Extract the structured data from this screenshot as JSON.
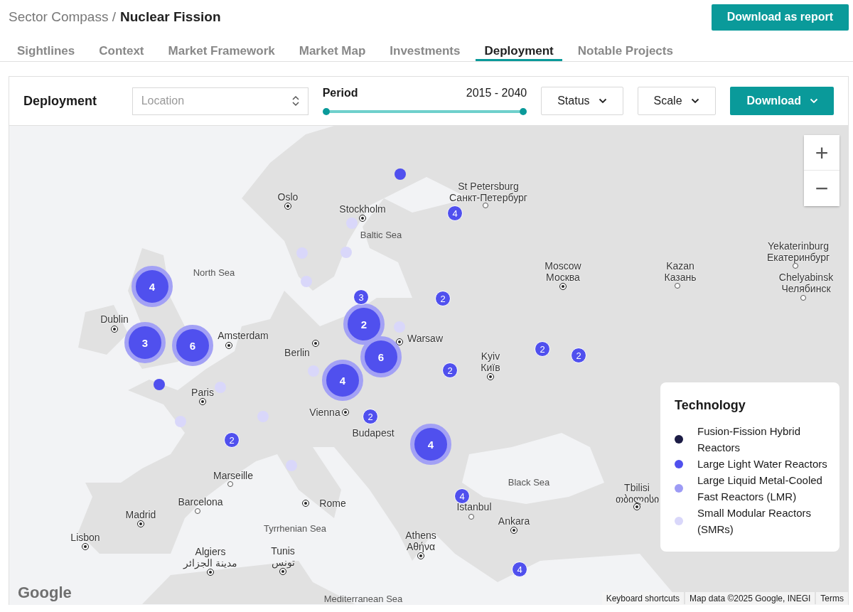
{
  "breadcrumb": {
    "parent": "Sector Compass /",
    "current": "Nuclear Fission"
  },
  "report_button": "Download as report",
  "tabs": [
    {
      "label": "Sightlines",
      "selected": false
    },
    {
      "label": "Context",
      "selected": false
    },
    {
      "label": "Market Framework",
      "selected": false
    },
    {
      "label": "Market Map",
      "selected": false
    },
    {
      "label": "Investments",
      "selected": false
    },
    {
      "label": "Deployment",
      "selected": true
    },
    {
      "label": "Notable Projects",
      "selected": false
    }
  ],
  "toolbar": {
    "title": "Deployment",
    "location": {
      "placeholder": "Location"
    },
    "period": {
      "label": "Period",
      "range": "2015 - 2040",
      "level": 1
    },
    "buttons": [
      {
        "label": "Status",
        "kind": "outline"
      },
      {
        "label": "Scale",
        "kind": "outline"
      },
      {
        "label": "Download",
        "kind": "primary"
      }
    ]
  },
  "map": {
    "cities": [
      {
        "name": "Oslo",
        "kind": "capital"
      },
      {
        "name": "Stockholm",
        "kind": "capital"
      },
      {
        "name": "St Petersburg",
        "native": "Санкт-Петербург",
        "kind": "city"
      },
      {
        "name": "Moscow",
        "native": "Москва",
        "kind": "capital"
      },
      {
        "name": "Kazan",
        "native": "Казань",
        "kind": "city"
      },
      {
        "name": "Yekaterinburg",
        "native": "Екатеринбург",
        "kind": "city"
      },
      {
        "name": "Chelyabinsk",
        "native": "Челябинск",
        "kind": "city"
      },
      {
        "name": "Dublin",
        "kind": "capital"
      },
      {
        "name": "Amsterdam",
        "kind": "capital"
      },
      {
        "name": "Berlin",
        "kind": "capital"
      },
      {
        "name": "Warsaw",
        "kind": "capital"
      },
      {
        "name": "Paris",
        "kind": "capital"
      },
      {
        "name": "Vienna",
        "kind": "capital"
      },
      {
        "name": "Budapest"
      },
      {
        "name": "Kyiv",
        "native": "Київ",
        "kind": "capital"
      },
      {
        "name": "Marseille",
        "kind": "city"
      },
      {
        "name": "Barcelona",
        "kind": "city"
      },
      {
        "name": "Madrid",
        "kind": "capital"
      },
      {
        "name": "Rome",
        "kind": "capital"
      },
      {
        "name": "Lisbon",
        "kind": "capital"
      },
      {
        "name": "Algiers",
        "native": "مدينة الجزائر",
        "kind": "capital"
      },
      {
        "name": "Tunis",
        "native": "تونس",
        "kind": "capital"
      },
      {
        "name": "Athens",
        "native": "Αθήνα",
        "kind": "capital"
      },
      {
        "name": "Istanbul",
        "kind": "city"
      },
      {
        "name": "Ankara",
        "kind": "capital"
      },
      {
        "name": "Tbilisi",
        "native": "თბილისი",
        "kind": "capital"
      }
    ],
    "seas": [
      "North Sea",
      "Baltic Sea",
      "Black Sea",
      "Tyrrhenian Sea",
      "Mediterranean Sea"
    ],
    "markers": [
      {
        "kind": "dot",
        "color": "#5050ee"
      },
      {
        "kind": "dot",
        "color": "#d9d7fa"
      },
      {
        "kind": "dot",
        "color": "#d9d7fa"
      },
      {
        "kind": "dot",
        "color": "#d9d7fa"
      },
      {
        "kind": "dot",
        "color": "#d9d7fa"
      },
      {
        "kind": "dot",
        "color": "#d9d7fa"
      },
      {
        "kind": "dot",
        "color": "#5050ee"
      },
      {
        "kind": "dot",
        "color": "#d9d7fa"
      },
      {
        "kind": "dot",
        "color": "#d9d7fa"
      },
      {
        "kind": "dot",
        "color": "#d9d7fa"
      },
      {
        "kind": "dot",
        "color": "#d9d7fa"
      },
      {
        "kind": "dot",
        "color": "#d9d7fa"
      },
      {
        "kind": "bubble",
        "count": "4",
        "color": "#5050ee"
      },
      {
        "kind": "bubble",
        "count": "3",
        "color": "#5050ee"
      },
      {
        "kind": "bubble",
        "count": "6",
        "color": "#5050ee"
      },
      {
        "kind": "bubble",
        "count": "2",
        "color": "#5050ee"
      },
      {
        "kind": "bubble",
        "count": "6",
        "color": "#5050ee"
      },
      {
        "kind": "bubble",
        "count": "4",
        "color": "#5050ee"
      },
      {
        "kind": "bubble",
        "count": "4",
        "color": "#5050ee"
      },
      {
        "kind": "cluster",
        "count": "4",
        "color": "#5050ee"
      },
      {
        "kind": "cluster",
        "count": "3",
        "color": "#5050ee"
      },
      {
        "kind": "cluster",
        "count": "2",
        "color": "#5050ee"
      },
      {
        "kind": "cluster",
        "count": "2",
        "color": "#5050ee"
      },
      {
        "kind": "cluster",
        "count": "2",
        "color": "#5050ee"
      },
      {
        "kind": "cluster",
        "count": "2",
        "color": "#5050ee"
      },
      {
        "kind": "cluster",
        "count": "2",
        "color": "#5050ee"
      },
      {
        "kind": "cluster",
        "count": "2",
        "color": "#5050ee"
      },
      {
        "kind": "cluster",
        "count": "4",
        "color": "#5050ee"
      },
      {
        "kind": "cluster",
        "count": "4",
        "color": "#5050ee"
      }
    ],
    "zoom": {
      "in": "+",
      "out": "−"
    },
    "legend": {
      "title": "Technology",
      "items": [
        {
          "label": "Fusion-Fission Hybrid Reactors",
          "color": "#1c1c45"
        },
        {
          "label": "Large Light Water Reactors",
          "color": "#5050ee"
        },
        {
          "label": "Large Liquid Metal-Cooled Fast Reactors (LMR)",
          "color": "#9d9bf5"
        },
        {
          "label": "Small Modular Reactors (SMRs)",
          "color": "#d9d7fa"
        }
      ]
    },
    "logo": "Google",
    "attribution": [
      "Keyboard shortcuts",
      "Map data ©2025 Google, INEGI",
      "Terms"
    ]
  }
}
